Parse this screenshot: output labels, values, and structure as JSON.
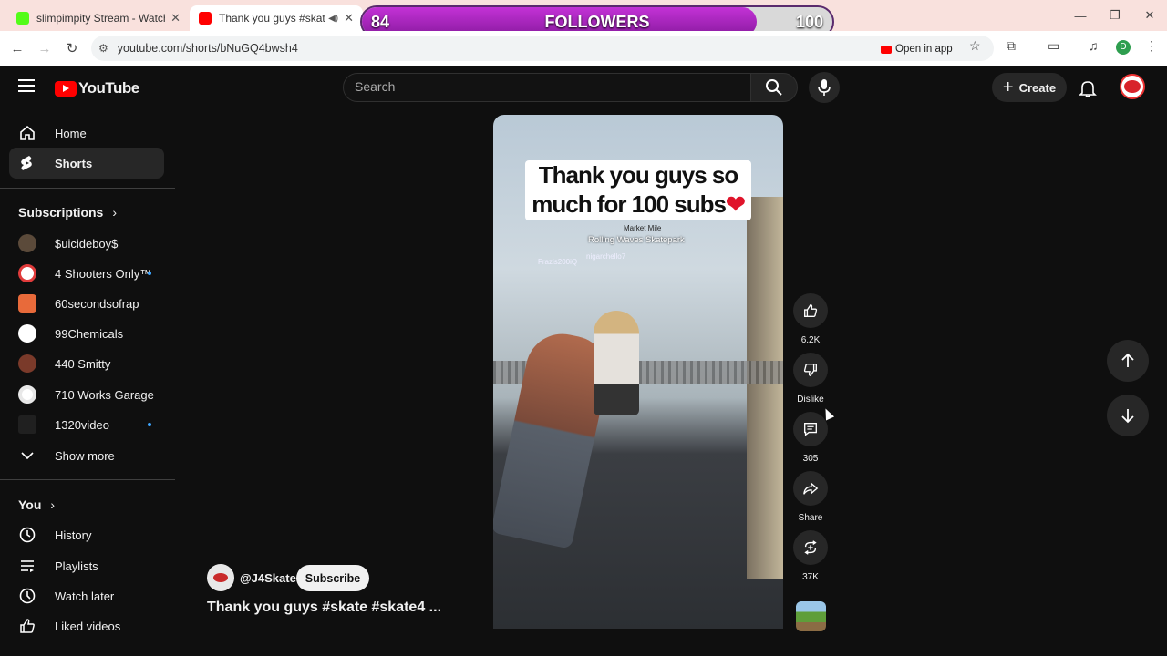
{
  "browser": {
    "tabs": [
      {
        "title": "slimpimpity Stream - Watch Liv",
        "favicon_color": "#53fc18"
      },
      {
        "title": "Thank you guys #skate #ska",
        "favicon_color": "#ff0000",
        "active": true
      }
    ],
    "url": "youtube.com/shorts/bNuGQ4bwsh4",
    "open_in_app": "Open in app",
    "profile_initial": "D"
  },
  "overlay": {
    "current": "84",
    "label": "FOLLOWERS",
    "goal": "100",
    "progress": 0.84
  },
  "header": {
    "logo_text": "YouTube",
    "search_placeholder": "Search",
    "create_label": "Create"
  },
  "sidebar": {
    "main": [
      {
        "label": "Home",
        "icon": "home-icon"
      },
      {
        "label": "Shorts",
        "icon": "shorts-icon",
        "active": true
      }
    ],
    "subscriptions_title": "Subscriptions",
    "subscriptions": [
      {
        "label": "$uicideboy$",
        "color": "#5b4a3a",
        "new": false
      },
      {
        "label": "4 Shooters Only™",
        "color": "#e03b3b",
        "new": true
      },
      {
        "label": "60secondsofrap",
        "color": "#e86a3a",
        "new": false
      },
      {
        "label": "99Chemicals",
        "color": "#ffffff",
        "new": false
      },
      {
        "label": "440 Smitty",
        "color": "#7a3a2a",
        "new": false
      },
      {
        "label": "710 Works Garage",
        "color": "#ffffff",
        "new": false
      },
      {
        "label": "1320video",
        "color": "#202020",
        "new": true
      }
    ],
    "show_more": "Show more",
    "you_title": "You",
    "you": [
      {
        "label": "History",
        "icon": "history-icon"
      },
      {
        "label": "Playlists",
        "icon": "playlists-icon"
      },
      {
        "label": "Watch later",
        "icon": "watch-later-icon"
      },
      {
        "label": "Liked videos",
        "icon": "liked-videos-icon"
      }
    ]
  },
  "video": {
    "caption_line1": "Thank you guys so",
    "caption_line2": "much for 100 subs",
    "caption_heart": "❤",
    "hud_location": "Market Mile",
    "hud_park": "Rolling Waves Skatepark",
    "hud_player1": "Frazis200iQ",
    "hud_player2": "nigarchello7"
  },
  "actions": {
    "likes": "6.2K",
    "dislike": "Dislike",
    "comments": "305",
    "share": "Share",
    "remix": "37K"
  },
  "channel": {
    "handle": "@J4Skate",
    "subscribe": "Subscribe",
    "title": "Thank you guys #skate #skate4 ..."
  }
}
